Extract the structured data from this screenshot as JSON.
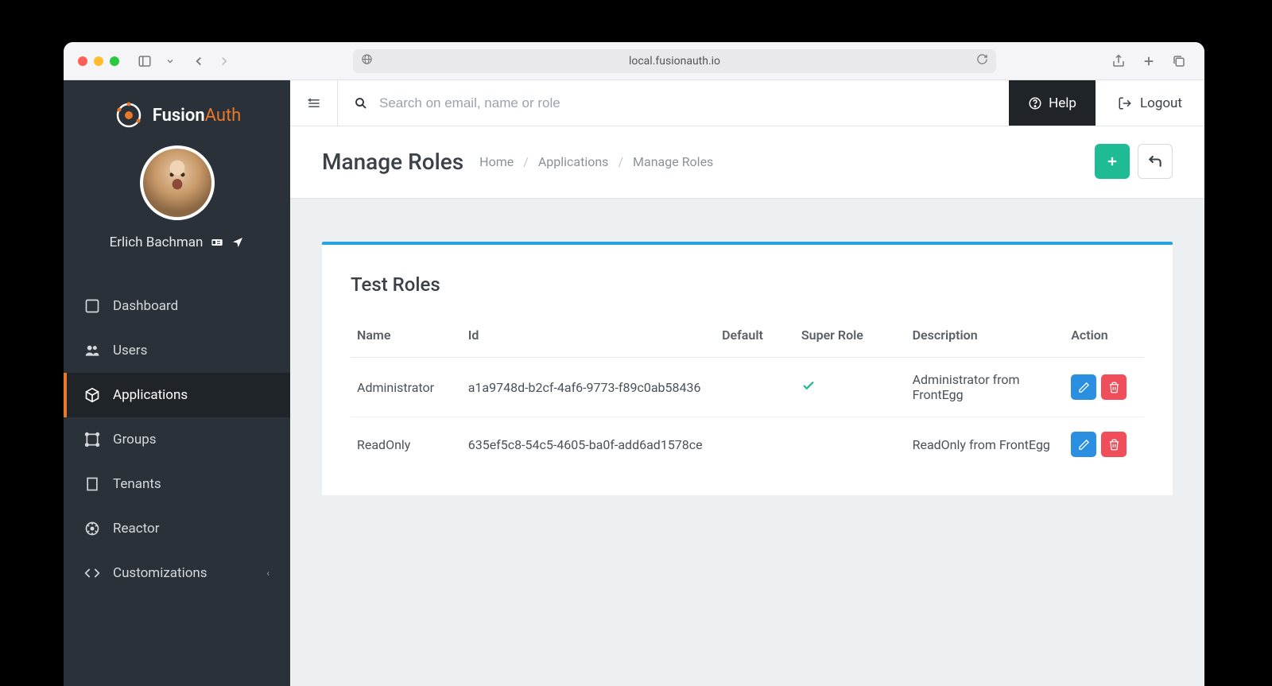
{
  "browser": {
    "url": "local.fusionauth.io"
  },
  "brand": {
    "name": "Fusion",
    "suffix": "Auth"
  },
  "user": {
    "display_name": "Erlich Bachman"
  },
  "sidebar": {
    "items": [
      {
        "label": "Dashboard",
        "icon": "dashboard-icon"
      },
      {
        "label": "Users",
        "icon": "users-icon"
      },
      {
        "label": "Applications",
        "icon": "applications-icon",
        "active": true
      },
      {
        "label": "Groups",
        "icon": "groups-icon"
      },
      {
        "label": "Tenants",
        "icon": "tenants-icon"
      },
      {
        "label": "Reactor",
        "icon": "reactor-icon"
      },
      {
        "label": "Customizations",
        "icon": "customizations-icon",
        "expandable": true
      }
    ]
  },
  "topbar": {
    "search_placeholder": "Search on email, name or role",
    "help_label": "Help",
    "logout_label": "Logout"
  },
  "page": {
    "title": "Manage Roles",
    "breadcrumbs": [
      "Home",
      "Applications",
      "Manage Roles"
    ]
  },
  "card": {
    "title": "Test Roles",
    "columns": [
      "Name",
      "Id",
      "Default",
      "Super Role",
      "Description",
      "Action"
    ],
    "rows": [
      {
        "name": "Administrator",
        "id": "a1a9748d-b2cf-4af6-9773-f89c0ab58436",
        "default": false,
        "super_role": true,
        "description": "Administrator from FrontEgg"
      },
      {
        "name": "ReadOnly",
        "id": "635ef5c8-54c5-4605-ba0f-add6ad1578ce",
        "default": false,
        "super_role": false,
        "description": "ReadOnly from FrontEgg"
      }
    ]
  }
}
